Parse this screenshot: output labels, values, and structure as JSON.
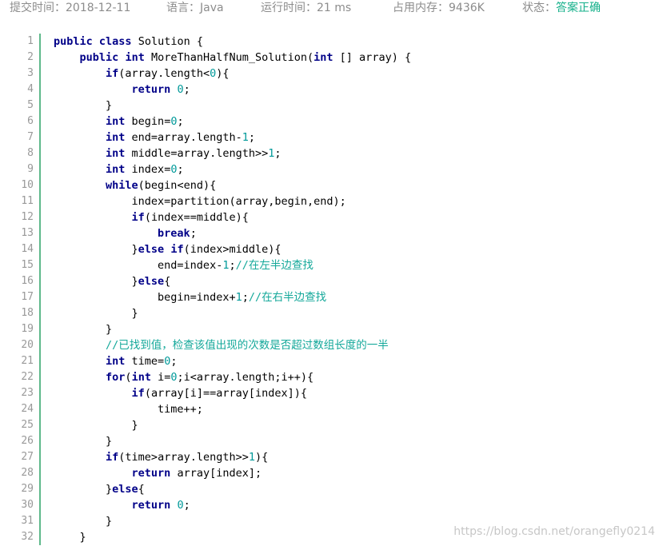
{
  "meta": {
    "submit_time": {
      "label": "提交时间：",
      "value": "2018-12-11"
    },
    "language": {
      "label": "语言：",
      "value": "Java"
    },
    "run_time": {
      "label": "运行时间：",
      "value": "21 ms"
    },
    "memory": {
      "label": "占用内存：",
      "value": "9436K"
    },
    "status": {
      "label": "状态：",
      "value": "答案正确"
    }
  },
  "colors": {
    "status_ok": "#14b08a",
    "keyword": "#000088",
    "number": "#009999",
    "comment": "#14a89a",
    "gutter_border": "#5fb98b"
  },
  "code": {
    "line_numbers": [
      "1",
      "2",
      "3",
      "4",
      "5",
      "6",
      "7",
      "8",
      "9",
      "10",
      "11",
      "12",
      "13",
      "14",
      "15",
      "16",
      "17",
      "18",
      "19",
      "20",
      "21",
      "22",
      "23",
      "24",
      "25",
      "26",
      "27",
      "28",
      "29",
      "30",
      "31",
      "32"
    ],
    "lines": [
      [
        {
          "t": "kw",
          "s": "public"
        },
        {
          "t": "p",
          "s": " "
        },
        {
          "t": "kw",
          "s": "class"
        },
        {
          "t": "p",
          "s": " Solution {"
        }
      ],
      [
        {
          "t": "p",
          "s": "    "
        },
        {
          "t": "kw",
          "s": "public"
        },
        {
          "t": "p",
          "s": " "
        },
        {
          "t": "kw",
          "s": "int"
        },
        {
          "t": "p",
          "s": " MoreThanHalfNum_Solution("
        },
        {
          "t": "kw",
          "s": "int"
        },
        {
          "t": "p",
          "s": " [] array) {"
        }
      ],
      [
        {
          "t": "p",
          "s": "        "
        },
        {
          "t": "kw",
          "s": "if"
        },
        {
          "t": "p",
          "s": "(array.length<"
        },
        {
          "t": "num",
          "s": "0"
        },
        {
          "t": "p",
          "s": "){"
        }
      ],
      [
        {
          "t": "p",
          "s": "            "
        },
        {
          "t": "kw",
          "s": "return"
        },
        {
          "t": "p",
          "s": " "
        },
        {
          "t": "num",
          "s": "0"
        },
        {
          "t": "p",
          "s": ";"
        }
      ],
      [
        {
          "t": "p",
          "s": "        }"
        }
      ],
      [
        {
          "t": "p",
          "s": "        "
        },
        {
          "t": "kw",
          "s": "int"
        },
        {
          "t": "p",
          "s": " begin="
        },
        {
          "t": "num",
          "s": "0"
        },
        {
          "t": "p",
          "s": ";"
        }
      ],
      [
        {
          "t": "p",
          "s": "        "
        },
        {
          "t": "kw",
          "s": "int"
        },
        {
          "t": "p",
          "s": " end=array.length-"
        },
        {
          "t": "num",
          "s": "1"
        },
        {
          "t": "p",
          "s": ";"
        }
      ],
      [
        {
          "t": "p",
          "s": "        "
        },
        {
          "t": "kw",
          "s": "int"
        },
        {
          "t": "p",
          "s": " middle=array.length>>"
        },
        {
          "t": "num",
          "s": "1"
        },
        {
          "t": "p",
          "s": ";"
        }
      ],
      [
        {
          "t": "p",
          "s": "        "
        },
        {
          "t": "kw",
          "s": "int"
        },
        {
          "t": "p",
          "s": " index="
        },
        {
          "t": "num",
          "s": "0"
        },
        {
          "t": "p",
          "s": ";"
        }
      ],
      [
        {
          "t": "p",
          "s": "        "
        },
        {
          "t": "kw",
          "s": "while"
        },
        {
          "t": "p",
          "s": "(begin<end){"
        }
      ],
      [
        {
          "t": "p",
          "s": "            index=partition(array,begin,end);"
        }
      ],
      [
        {
          "t": "p",
          "s": "            "
        },
        {
          "t": "kw",
          "s": "if"
        },
        {
          "t": "p",
          "s": "(index==middle){"
        }
      ],
      [
        {
          "t": "p",
          "s": "                "
        },
        {
          "t": "kw",
          "s": "break"
        },
        {
          "t": "p",
          "s": ";"
        }
      ],
      [
        {
          "t": "p",
          "s": "            }"
        },
        {
          "t": "kw",
          "s": "else"
        },
        {
          "t": "p",
          "s": " "
        },
        {
          "t": "kw",
          "s": "if"
        },
        {
          "t": "p",
          "s": "(index>middle){"
        }
      ],
      [
        {
          "t": "p",
          "s": "                end=index-"
        },
        {
          "t": "num",
          "s": "1"
        },
        {
          "t": "p",
          "s": ";"
        },
        {
          "t": "cm",
          "s": "//在左半边查找"
        }
      ],
      [
        {
          "t": "p",
          "s": "            }"
        },
        {
          "t": "kw",
          "s": "else"
        },
        {
          "t": "p",
          "s": "{"
        }
      ],
      [
        {
          "t": "p",
          "s": "                begin=index+"
        },
        {
          "t": "num",
          "s": "1"
        },
        {
          "t": "p",
          "s": ";"
        },
        {
          "t": "cm",
          "s": "//在右半边查找"
        }
      ],
      [
        {
          "t": "p",
          "s": "            }"
        }
      ],
      [
        {
          "t": "p",
          "s": "        }"
        }
      ],
      [
        {
          "t": "p",
          "s": "        "
        },
        {
          "t": "cm",
          "s": "//已找到值，检查该值出现的次数是否超过数组长度的一半"
        }
      ],
      [
        {
          "t": "p",
          "s": "        "
        },
        {
          "t": "kw",
          "s": "int"
        },
        {
          "t": "p",
          "s": " time="
        },
        {
          "t": "num",
          "s": "0"
        },
        {
          "t": "p",
          "s": ";"
        }
      ],
      [
        {
          "t": "p",
          "s": "        "
        },
        {
          "t": "kw",
          "s": "for"
        },
        {
          "t": "p",
          "s": "("
        },
        {
          "t": "kw",
          "s": "int"
        },
        {
          "t": "p",
          "s": " i="
        },
        {
          "t": "num",
          "s": "0"
        },
        {
          "t": "p",
          "s": ";i<array.length;i++){"
        }
      ],
      [
        {
          "t": "p",
          "s": "            "
        },
        {
          "t": "kw",
          "s": "if"
        },
        {
          "t": "p",
          "s": "(array[i]==array[index]){"
        }
      ],
      [
        {
          "t": "p",
          "s": "                time++;"
        }
      ],
      [
        {
          "t": "p",
          "s": "            }"
        }
      ],
      [
        {
          "t": "p",
          "s": "        }"
        }
      ],
      [
        {
          "t": "p",
          "s": "        "
        },
        {
          "t": "kw",
          "s": "if"
        },
        {
          "t": "p",
          "s": "(time>array.length>>"
        },
        {
          "t": "num",
          "s": "1"
        },
        {
          "t": "p",
          "s": "){"
        }
      ],
      [
        {
          "t": "p",
          "s": "            "
        },
        {
          "t": "kw",
          "s": "return"
        },
        {
          "t": "p",
          "s": " array[index];"
        }
      ],
      [
        {
          "t": "p",
          "s": "        }"
        },
        {
          "t": "kw",
          "s": "else"
        },
        {
          "t": "p",
          "s": "{"
        }
      ],
      [
        {
          "t": "p",
          "s": "            "
        },
        {
          "t": "kw",
          "s": "return"
        },
        {
          "t": "p",
          "s": " "
        },
        {
          "t": "num",
          "s": "0"
        },
        {
          "t": "p",
          "s": ";"
        }
      ],
      [
        {
          "t": "p",
          "s": "        }"
        }
      ],
      [
        {
          "t": "p",
          "s": "    }"
        }
      ]
    ]
  },
  "watermark": "https://blog.csdn.net/orangefly0214"
}
